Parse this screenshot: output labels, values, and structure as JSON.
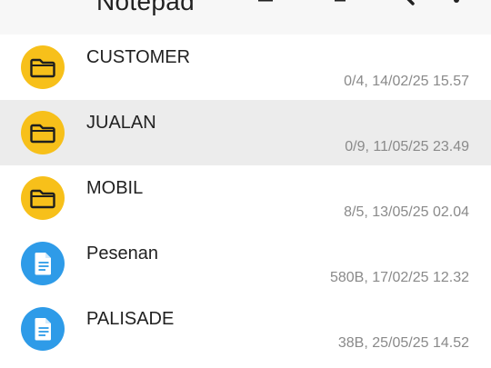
{
  "app": {
    "title": "Notepad"
  },
  "icons": {
    "menu": "hamburger-menu-icon",
    "search": "search-icon",
    "more": "more-vert-icon"
  },
  "colors": {
    "folder": "#f7c01a",
    "file": "#2e9be8",
    "selected_row": "#ececec"
  },
  "items": [
    {
      "type": "folder",
      "name": "CUSTOMER",
      "meta": "0/4,  14/02/25 15.57"
    },
    {
      "type": "folder",
      "name": "JUALAN",
      "meta": "0/9,  11/05/25 23.49",
      "selected": true
    },
    {
      "type": "folder",
      "name": "MOBIL",
      "meta": "8/5,  13/05/25 02.04"
    },
    {
      "type": "file",
      "name": "Pesenan",
      "meta": "580B,  17/02/25 12.32"
    },
    {
      "type": "file",
      "name": "PALISADE",
      "meta": "38B,  25/05/25 14.52"
    }
  ]
}
